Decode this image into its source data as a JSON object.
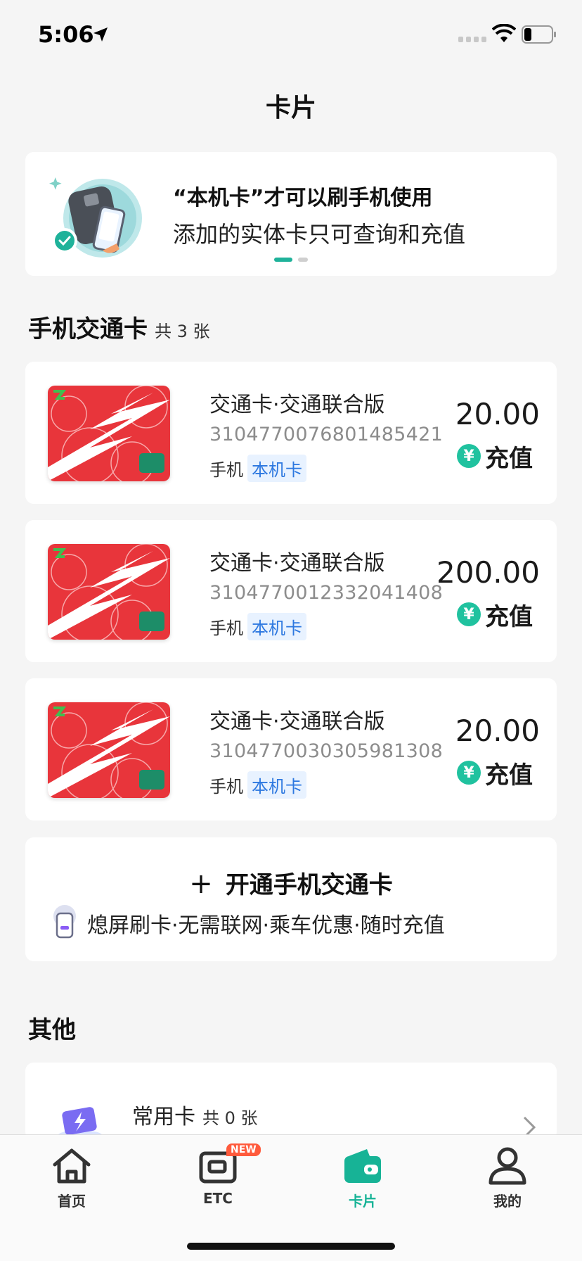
{
  "status_bar": {
    "time": "5:06"
  },
  "page": {
    "title": "卡片"
  },
  "banner": {
    "line1": "“本机卡”才可以刷手机使用",
    "line2": "添加的实体卡只可查询和充值"
  },
  "section_transit": {
    "title": "手机交通卡",
    "count": "共 3 张"
  },
  "cards": [
    {
      "name": "交通卡·交通联合版",
      "number": "31047700768014854​21",
      "phone_label": "手机",
      "badge": "本机卡",
      "amount": "20.00",
      "recharge": "充值"
    },
    {
      "name": "交通卡·交通联合版",
      "number": "3104770012332041408",
      "phone_label": "手机",
      "badge": "本机卡",
      "amount": "200.00",
      "recharge": "充值"
    },
    {
      "name": "交通卡·交通联合版",
      "number": "3104770030305981308",
      "phone_label": "手机",
      "badge": "本机卡",
      "amount": "20.00",
      "recharge": "充值"
    }
  ],
  "open_card": {
    "plus": "+",
    "title": "开通手机交通卡",
    "subtitle": "熄屏刷卡·无需联网·乘车优惠·随时充值"
  },
  "section_other": {
    "title": "其他"
  },
  "common_card": {
    "label": "常用卡",
    "count": "共 0 张"
  },
  "tabbar": {
    "items": [
      {
        "label": "首页",
        "icon": "home-icon"
      },
      {
        "label": "ETC",
        "icon": "etc-icon",
        "badge": "NEW"
      },
      {
        "label": "卡片",
        "icon": "wallet-icon",
        "active": true
      },
      {
        "label": "我的",
        "icon": "person-icon"
      }
    ]
  },
  "colors": {
    "accent": "#17b396",
    "badge_blue": "#2d78e0",
    "card_red": "#e8353b"
  }
}
